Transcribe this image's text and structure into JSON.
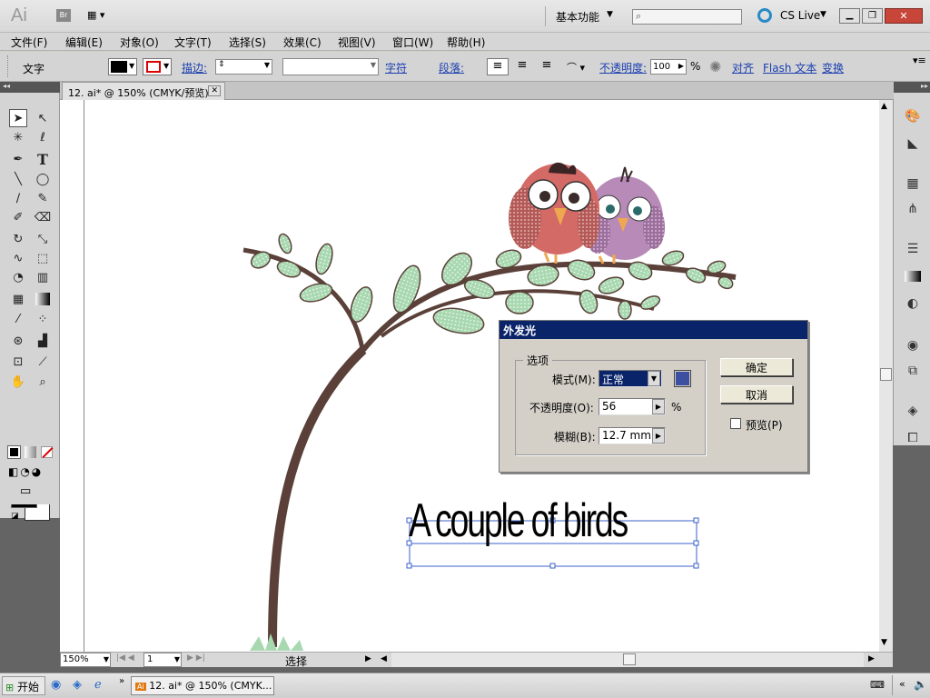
{
  "app": {
    "logo": "Ai",
    "bridge": "Br",
    "workspace": "基本功能",
    "cs_live": "CS Live"
  },
  "menu": [
    "文件(F)",
    "编辑(E)",
    "对象(O)",
    "文字(T)",
    "选择(S)",
    "效果(C)",
    "视图(V)",
    "窗口(W)",
    "帮助(H)"
  ],
  "control": {
    "tool_label": "文字",
    "stroke_label": "描边:",
    "char_label": "字符",
    "para_label": "段落:",
    "opacity_label": "不透明度:",
    "opacity_value": "100",
    "percent": "%",
    "align_label": "对齐",
    "flash_label": "Flash 文本",
    "transform_label": "变换"
  },
  "doc": {
    "tab_title": "12. ai* @ 150% (CMYK/预览)"
  },
  "canvas_text": "A couple of birds",
  "dialog": {
    "title": "外发光",
    "group_label": "选项",
    "mode_label": "模式(M):",
    "mode_value": "正常",
    "opacity_label": "不透明度(O):",
    "opacity_value": "56",
    "opacity_unit": "%",
    "blur_label": "模糊(B):",
    "blur_value": "12.7 mm",
    "ok": "确定",
    "cancel": "取消",
    "preview_label": "预览(P)",
    "glow_color": "#3c4fa0"
  },
  "status": {
    "zoom": "150%",
    "page": "1",
    "mode": "选择"
  },
  "taskbar": {
    "start": "开始",
    "task": "12. ai* @ 150% (CMYK..."
  },
  "colors": {
    "title_bg": "#0a246a",
    "link": "#1a3fb0",
    "branch": "#5a4038",
    "leaf": "#a8d8b0",
    "bird1": "#d46a66",
    "bird2": "#b78ab8"
  }
}
